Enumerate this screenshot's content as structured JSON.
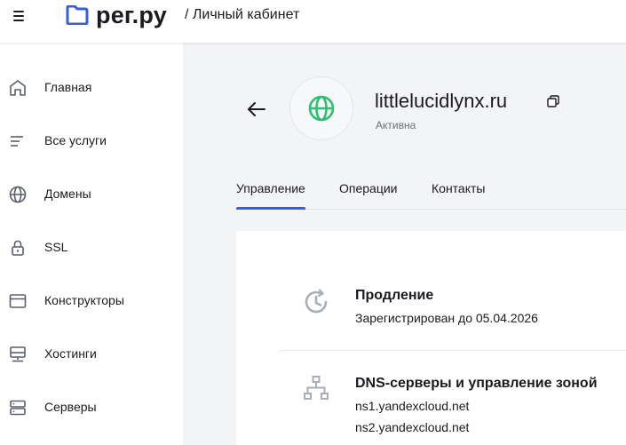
{
  "header": {
    "logo_text": "рег.ру",
    "section": "/ Личный кабинет"
  },
  "sidebar": {
    "items": [
      {
        "label": "Главная",
        "icon": "home-icon"
      },
      {
        "label": "Все услуги",
        "icon": "list-icon"
      },
      {
        "label": "Домены",
        "icon": "globe-icon"
      },
      {
        "label": "SSL",
        "icon": "lock-icon"
      },
      {
        "label": "Конструкторы",
        "icon": "browser-window-icon"
      },
      {
        "label": "Хостинги",
        "icon": "hosting-icon"
      },
      {
        "label": "Серверы",
        "icon": "server-icon"
      }
    ]
  },
  "domain": {
    "name": "littlelucidlynx.ru",
    "status": "Активна"
  },
  "tabs": [
    {
      "label": "Управление",
      "active": true
    },
    {
      "label": "Операции",
      "active": false
    },
    {
      "label": "Контакты",
      "active": false
    }
  ],
  "services": {
    "renewal": {
      "title": "Продление",
      "subtitle": "Зарегистрирован до 05.04.2026"
    },
    "dns": {
      "title": "DNS-серверы и управление зоной",
      "ns1": "ns1.yandexcloud.net",
      "ns2": "ns2.yandexcloud.net"
    }
  },
  "colors": {
    "accent": "#3b5bdb",
    "globe_green": "#2fbf71",
    "icon_gray": "#5a5f6b",
    "icon_light": "#a9adb5",
    "background": "#f3f4f6"
  }
}
